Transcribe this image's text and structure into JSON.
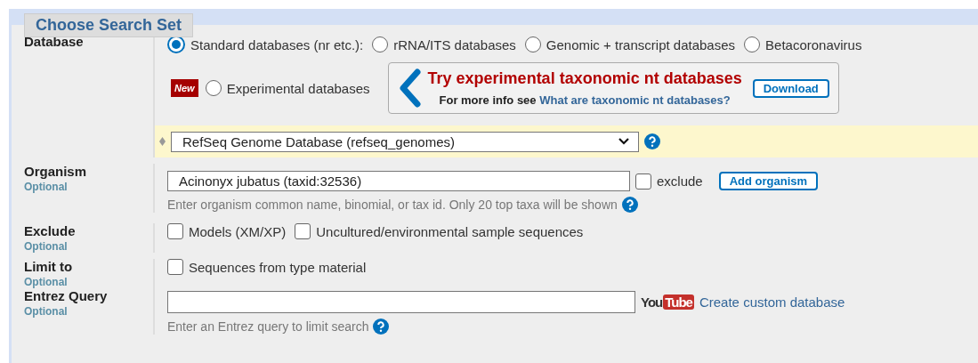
{
  "legend": "Choose Search Set",
  "database": {
    "label": "Database",
    "options": [
      {
        "label": "Standard databases (nr etc.):",
        "selected": true
      },
      {
        "label": "rRNA/ITS databases",
        "selected": false
      },
      {
        "label": "Genomic + transcript databases",
        "selected": false
      },
      {
        "label": "Betacoronavirus",
        "selected": false
      }
    ],
    "new_badge": "New",
    "experimental": {
      "label": "Experimental databases",
      "selected": false
    },
    "promo": {
      "title": "Try experimental taxonomic nt databases",
      "info": "For more info see",
      "link": "What are taxonomic nt databases?",
      "button": "Download"
    },
    "select": {
      "value": "RefSeq Genome Database (refseq_genomes)"
    }
  },
  "organism": {
    "label": "Organism",
    "optional": "Optional",
    "value": "Acinonyx jubatus (taxid:32536)",
    "exclude": {
      "label": "exclude",
      "checked": false
    },
    "button": "Add organism",
    "hint": "Enter organism common name, binomial, or tax id. Only 20 top taxa will be shown"
  },
  "exclude": {
    "label": "Exclude",
    "optional": "Optional",
    "options": [
      {
        "label": "Models (XM/XP)",
        "checked": false
      },
      {
        "label": "Uncultured/environmental sample sequences",
        "checked": false
      }
    ]
  },
  "limit_to": {
    "label": "Limit to",
    "optional": "Optional",
    "options": [
      {
        "label": "Sequences from type material",
        "checked": false
      }
    ]
  },
  "entrez": {
    "label": "Entrez Query",
    "optional": "Optional",
    "video_logo": [
      "You",
      "Tube"
    ],
    "link": "Create custom database",
    "hint": "Enter an Entrez query to limit search"
  }
}
